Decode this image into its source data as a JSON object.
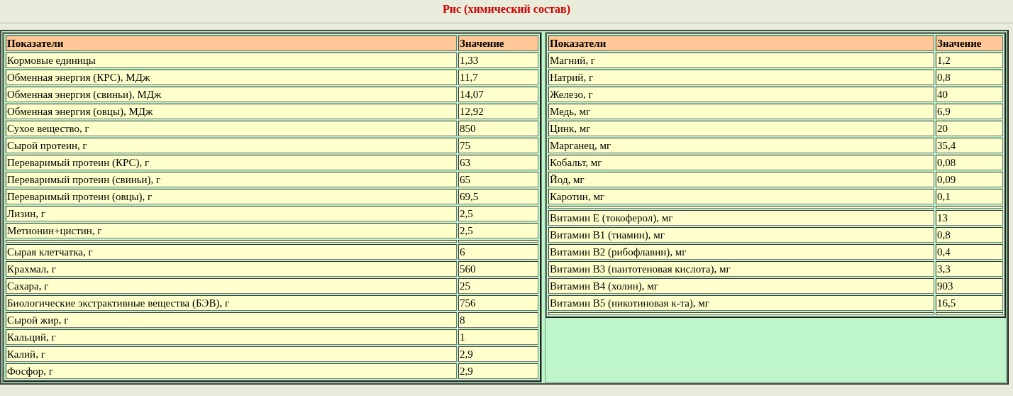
{
  "title": "Рис (химический состав)",
  "tables": [
    {
      "columns": [
        "Показатели",
        "Значение"
      ],
      "rows": [
        {
          "kind": "data",
          "label": "Кормовые единицы",
          "value": "1,33"
        },
        {
          "kind": "data",
          "label": "Обменная энергия (КРС), МДж",
          "value": "11,7"
        },
        {
          "kind": "data",
          "label": "Обменная энергия (свиньи), МДж",
          "value": "14,07"
        },
        {
          "kind": "data",
          "label": "Обменная энергия (овцы), МДж",
          "value": "12,92"
        },
        {
          "kind": "data",
          "label": "Сухое вещество, г",
          "value": "850"
        },
        {
          "kind": "data",
          "label": "Сырой протеин, г",
          "value": "75"
        },
        {
          "kind": "data",
          "label": "Переваримый протеин (КРС), г",
          "value": "63"
        },
        {
          "kind": "data",
          "label": "Переваримый протеин (свиньи), г",
          "value": "65"
        },
        {
          "kind": "data",
          "label": "Переваримый протеин (овцы), г",
          "value": "69,5"
        },
        {
          "kind": "data",
          "label": "Лизин, г",
          "value": "2,5"
        },
        {
          "kind": "data",
          "label": "Метионин+цистин, г",
          "value": "2,5"
        },
        {
          "kind": "divider"
        },
        {
          "kind": "data",
          "label": "Сырая клетчатка, г",
          "value": "6"
        },
        {
          "kind": "data",
          "label": "Крахмал, г",
          "value": "560"
        },
        {
          "kind": "data",
          "label": "Сахара, г",
          "value": "25"
        },
        {
          "kind": "data",
          "label": "Биологические экстрактивные вещества (БЭВ), г",
          "value": "756"
        },
        {
          "kind": "data",
          "label": "Сырой жир, г",
          "value": "8"
        },
        {
          "kind": "data",
          "label": "Кальций, г",
          "value": "1"
        },
        {
          "kind": "data",
          "label": "Калий, г",
          "value": "2,9"
        },
        {
          "kind": "data",
          "label": "Фосфор, г",
          "value": "2,9"
        }
      ]
    },
    {
      "columns": [
        "Показатели",
        "Значение"
      ],
      "rows": [
        {
          "kind": "data",
          "label": "Магний, г",
          "value": "1,2"
        },
        {
          "kind": "data",
          "label": "Натрий, г",
          "value": "0,8"
        },
        {
          "kind": "data",
          "label": "Железо, г",
          "value": "40"
        },
        {
          "kind": "data",
          "label": "Медь, мг",
          "value": "6,9"
        },
        {
          "kind": "data",
          "label": "Цинк, мг",
          "value": "20"
        },
        {
          "kind": "data",
          "label": "Марганец, мг",
          "value": "35,4"
        },
        {
          "kind": "data",
          "label": "Кобальт, мг",
          "value": "0,08"
        },
        {
          "kind": "data",
          "label": "Йод, мг",
          "value": "0,09"
        },
        {
          "kind": "data",
          "label": "Каротин, мг",
          "value": "0,1"
        },
        {
          "kind": "divider"
        },
        {
          "kind": "data",
          "label": "Витамин E (токоферол), мг",
          "value": "13"
        },
        {
          "kind": "data",
          "label": "Витамин B1 (тиамин), мг",
          "value": "0,8"
        },
        {
          "kind": "data",
          "label": "Витамин B2 (рибофлавин), мг",
          "value": "0,4"
        },
        {
          "kind": "data",
          "label": "Витамин B3 (пантотеновая кислота), мг",
          "value": "3,3"
        },
        {
          "kind": "data",
          "label": "Витамин B4 (холин), мг",
          "value": "903"
        },
        {
          "kind": "data",
          "label": "Витамин B5 (никотиновая к-та), мг",
          "value": "16,5"
        },
        {
          "kind": "divider"
        }
      ]
    }
  ]
}
